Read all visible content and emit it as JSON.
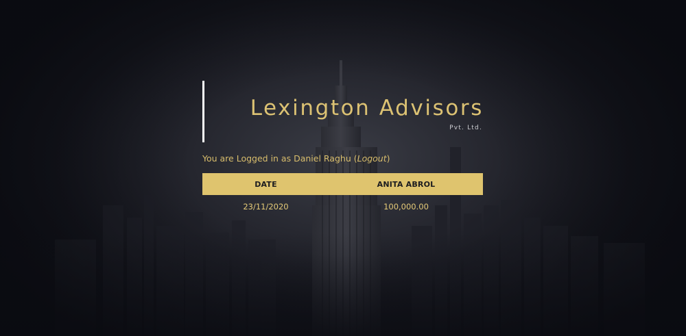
{
  "brand": {
    "name": "Lexington Advisors",
    "suffix": "Pvt. Ltd."
  },
  "session": {
    "prefix": "You are Logged in as Daniel Raghu (",
    "logout_label": "Logout",
    "suffix": ")"
  },
  "table": {
    "headers": [
      "DATE",
      "ANITA ABROL"
    ],
    "rows": [
      [
        "23/11/2020",
        "100,000.00"
      ]
    ]
  },
  "colors": {
    "accent": "#dfc46e",
    "text_gold": "#d8bd6c",
    "background": "#12131a"
  }
}
